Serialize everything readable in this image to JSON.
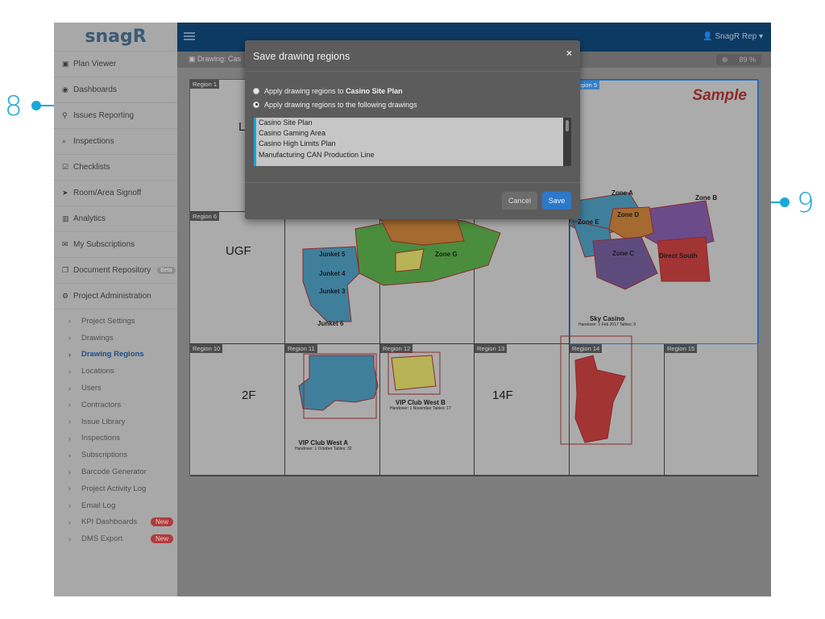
{
  "callouts": {
    "left": "8",
    "right": "9"
  },
  "app": {
    "logo": "snagR"
  },
  "sidebar": {
    "items": [
      {
        "icon": "image-icon",
        "glyph": "▣",
        "label": "Plan Viewer"
      },
      {
        "icon": "dashboard-icon",
        "glyph": "◉",
        "label": "Dashboards"
      },
      {
        "icon": "pin-icon",
        "glyph": "⚲",
        "label": "Issues Reporting"
      },
      {
        "icon": "search-icon",
        "glyph": "⌕",
        "label": "Inspections"
      },
      {
        "icon": "checkbox-icon",
        "glyph": "☑",
        "label": "Checklists"
      },
      {
        "icon": "location-arrow-icon",
        "glyph": "➤",
        "label": "Room/Area Signoff"
      },
      {
        "icon": "bar-chart-icon",
        "glyph": "▥",
        "label": "Analytics"
      },
      {
        "icon": "envelope-icon",
        "glyph": "✉",
        "label": "My Subscriptions"
      },
      {
        "icon": "copy-icon",
        "glyph": "❐",
        "label": "Document Repository",
        "badge": "Beta"
      },
      {
        "icon": "cogs-icon",
        "glyph": "⚙",
        "label": "Project Administration"
      }
    ],
    "sub_items": [
      {
        "label": "Project Settings"
      },
      {
        "label": "Drawings"
      },
      {
        "label": "Drawing Regions",
        "active": true
      },
      {
        "label": "Locations"
      },
      {
        "label": "Users"
      },
      {
        "label": "Contractors"
      },
      {
        "label": "Issue Library"
      },
      {
        "label": "Inspections"
      },
      {
        "label": "Subscriptions"
      },
      {
        "label": "Barcode Generator"
      },
      {
        "label": "Project Activity Log"
      },
      {
        "label": "Email Log"
      },
      {
        "label": "KPI Dashboards",
        "badge": "New"
      },
      {
        "label": "DMS Export",
        "badge": "New"
      }
    ]
  },
  "topbar": {
    "user_label": "SnagR Rep ▾",
    "user_icon": "user-icon"
  },
  "drawbar": {
    "label": "Drawing: Cas",
    "zoom": "89 %",
    "zoom_icon": "zoom-icon"
  },
  "canvas": {
    "sample_label": "Sample",
    "regions": [
      "Region 1",
      "Region 5",
      "Region 6",
      "Region 10",
      "Region 11",
      "Region 12",
      "Region 13",
      "Region 14",
      "Region 15"
    ],
    "floors": {
      "ugf": "UGF",
      "f2": "2F",
      "f14": "14F",
      "lg_partial": "L"
    },
    "zones": {
      "junket5": "Junket 5",
      "junket4": "Junket 4",
      "junket3": "Junket 3",
      "junket6": "Junket 6",
      "zone_g": "Zone G",
      "zone_a": "Zone A",
      "zone_b": "Zone B",
      "zone_c": "Zone C",
      "zone_d": "Zone D",
      "zone_e": "Zone E",
      "direct_south": "Direct South",
      "sky_casino": "Sky Casino",
      "sky_casino_sub": "Handover: 1 Feb 2017\nTables: 9",
      "vip_a": "VIP Club West A",
      "vip_a_sub": "Handover: 1 October\nTables: 32",
      "vip_b": "VIP Club West B",
      "vip_b_sub": "Handover: 1 November\nTables: 17"
    }
  },
  "modal": {
    "title": "Save drawing regions",
    "close": "×",
    "option1_prefix": "Apply drawing regions to ",
    "option1_bold": "Casino Site Plan",
    "option2": "Apply drawing regions to the following drawings",
    "drawings": [
      "Casino Site Plan",
      "Casino Gaming Area",
      "Casino High Limits Plan",
      "Manufacturing CAN Production Line"
    ],
    "cancel": "Cancel",
    "save": "Save"
  },
  "colors": {
    "accent": "#1aa7d8",
    "navy": "#0d3a63",
    "save": "#2d78c8"
  }
}
